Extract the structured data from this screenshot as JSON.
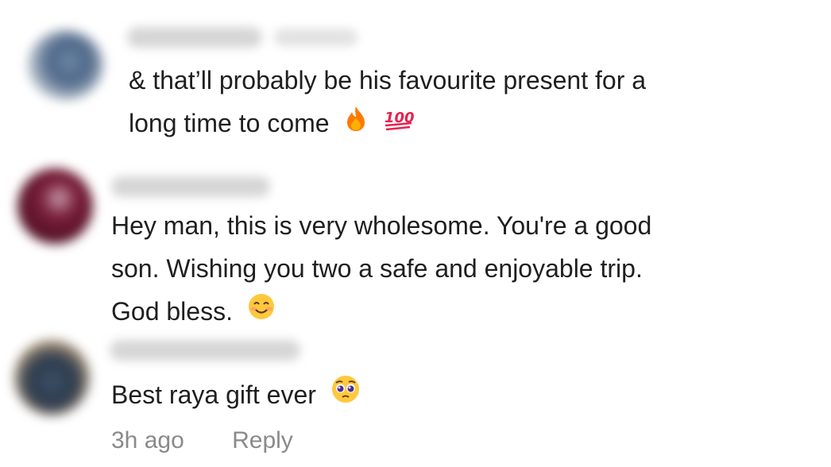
{
  "comments": [
    {
      "lines": [
        "& that’ll probably be his favourite present for a",
        "long time to come"
      ],
      "emojis": [
        "fire-emoji",
        "hundred-points-emoji"
      ]
    },
    {
      "lines": [
        "Hey man, this is very wholesome. You're a good",
        "son. Wishing you two a safe and enjoyable trip.",
        "God bless."
      ],
      "emojis": [
        "smiling-face-emoji"
      ]
    },
    {
      "lines": [
        "Best raya gift ever"
      ],
      "emojis": [
        "pleading-face-emoji"
      ]
    }
  ],
  "meta": {
    "time": "3h ago",
    "reply_label": "Reply"
  },
  "colors": {
    "text": "#1f1f1f",
    "meta": "#8a8a8a",
    "fire": "#ff7a00",
    "hundred": "#e8204d",
    "emoji_face": "#ffc83d"
  }
}
